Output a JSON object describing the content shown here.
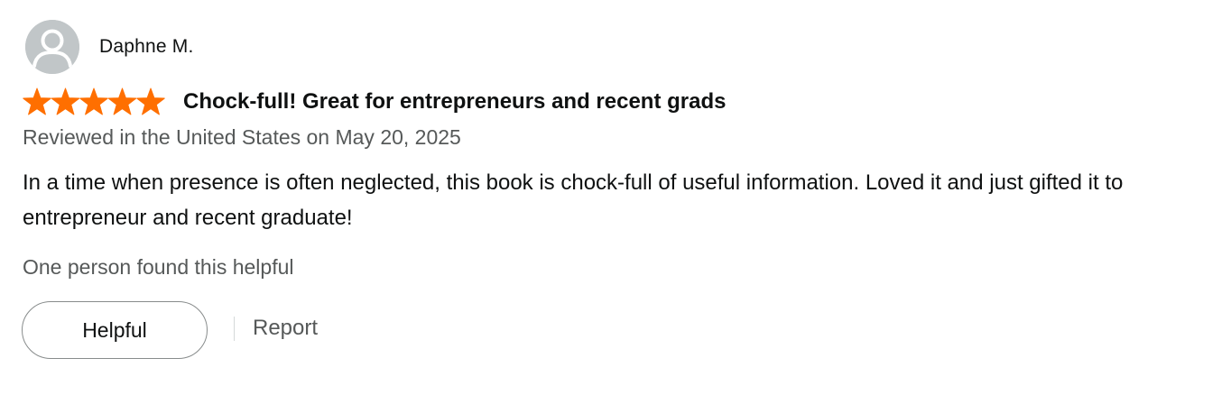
{
  "reviewer": {
    "name": "Daphne M.",
    "avatar_icon": "user-silhouette-icon"
  },
  "rating": {
    "stars": 5,
    "max": 5,
    "star_color": "#ff6f00",
    "star_icon": "star-icon"
  },
  "review": {
    "title": "Chock-full! Great for entrepreneurs and recent grads",
    "date_line": "Reviewed in the United States on May 20, 2025",
    "body": "In a time when presence is often neglected, this book is chock-full of useful information. Loved it and just gifted it to entrepreneur and recent graduate!"
  },
  "feedback": {
    "helpful_count_text": "One person found this helpful",
    "helpful_label": "Helpful",
    "report_label": "Report"
  }
}
